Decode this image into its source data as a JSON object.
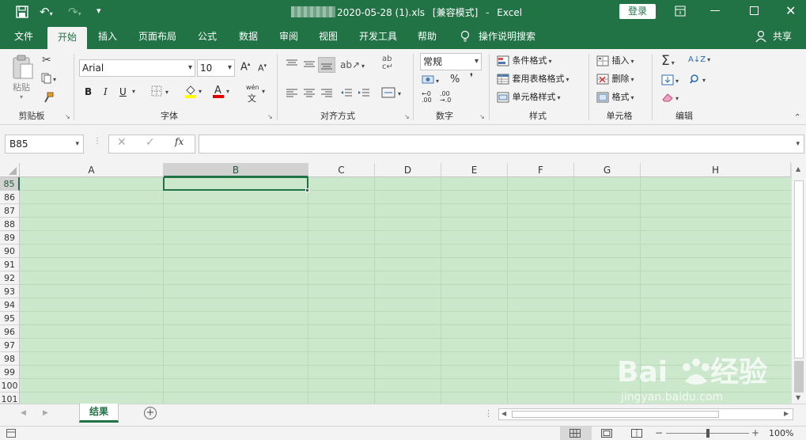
{
  "titlebar": {
    "filename": "2020-05-28 (1).xls",
    "mode": "[兼容模式]",
    "separator": "-",
    "app": "Excel",
    "login_label": "登录"
  },
  "tabs": [
    {
      "label": "文件"
    },
    {
      "label": "开始"
    },
    {
      "label": "插入"
    },
    {
      "label": "页面布局"
    },
    {
      "label": "公式"
    },
    {
      "label": "数据"
    },
    {
      "label": "审阅"
    },
    {
      "label": "视图"
    },
    {
      "label": "开发工具"
    },
    {
      "label": "帮助"
    },
    {
      "label": "操作说明搜索"
    }
  ],
  "share_label": "共享",
  "ribbon": {
    "clipboard": {
      "paste": "粘贴",
      "group": "剪贴板"
    },
    "font": {
      "name": "Arial",
      "size": "10",
      "bold": "B",
      "italic": "I",
      "underline": "U",
      "phonetic": "wén",
      "group": "字体"
    },
    "alignment": {
      "group": "对齐方式"
    },
    "number": {
      "format": "常规",
      "group": "数字"
    },
    "styles": {
      "conditional": "条件格式",
      "table": "套用表格格式",
      "cell": "单元格样式",
      "group": "样式"
    },
    "cells": {
      "insert": "插入",
      "delete": "删除",
      "format": "格式",
      "group": "单元格"
    },
    "editing": {
      "group": "编辑"
    }
  },
  "formula": {
    "namebox": "B85",
    "fx": "fx",
    "value": ""
  },
  "columns": [
    "A",
    "B",
    "C",
    "D",
    "E",
    "F",
    "G",
    "H"
  ],
  "rows": [
    "85",
    "86",
    "87",
    "88",
    "89",
    "90",
    "91",
    "92",
    "93",
    "94",
    "95",
    "96",
    "97",
    "98",
    "99",
    "100",
    "101"
  ],
  "selected_cell": "B85",
  "sheets": [
    {
      "label": "结果"
    }
  ],
  "status": {
    "zoom": "100%"
  },
  "colors": {
    "accent": "#217346",
    "cell_fill": "#cce8cc"
  },
  "watermark": "Baidu经验 jingyan.baidu.com"
}
